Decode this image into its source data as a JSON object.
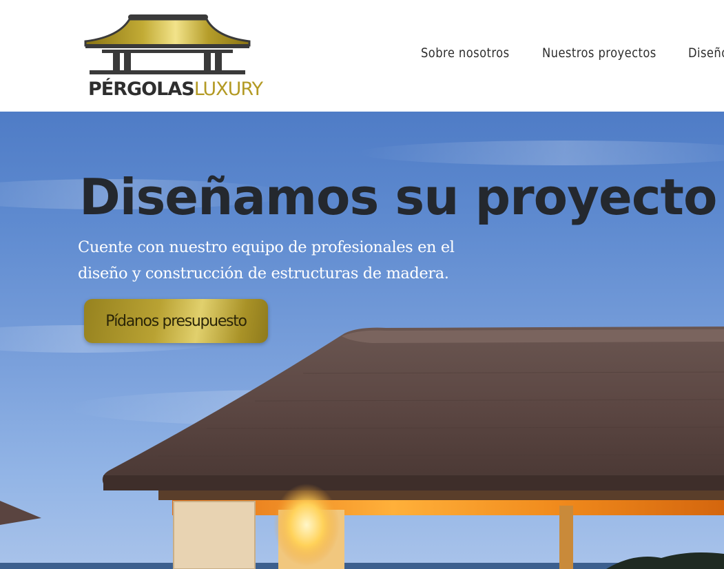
{
  "brand": {
    "name_part1": "PÉRGOLAS",
    "name_part2": "LUXURY",
    "gold_color": "#b39a24",
    "dark_color": "#2e2e2e"
  },
  "nav": {
    "items": [
      {
        "label": "Sobre nosotros"
      },
      {
        "label": "Nuestros proyectos"
      },
      {
        "label": "Diseño"
      }
    ]
  },
  "hero": {
    "title": "Diseñamos su proyecto",
    "subtitle": "Cuente con nuestro equipo de profesionales en el diseño y construcción de estructuras de madera.",
    "cta_label": "Pídanos presupuesto",
    "background_image": "thatched-roof-pergola-at-dusk"
  }
}
